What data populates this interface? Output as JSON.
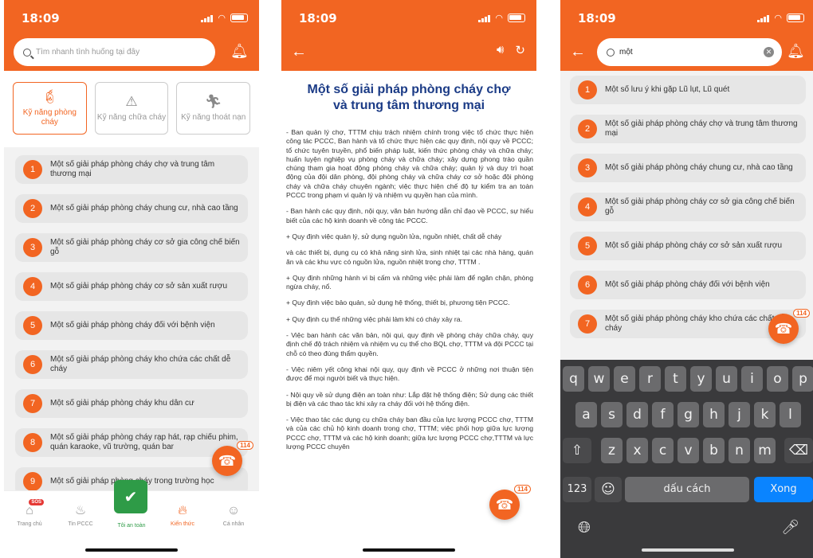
{
  "status": {
    "time": "18:09"
  },
  "screen1": {
    "search_placeholder": "Tìm nhanh tình huống tại đây",
    "skills": [
      {
        "icon": "fire-extinguisher-icon",
        "label": "Kỹ năng phòng cháy",
        "active": true
      },
      {
        "icon": "warning-icon",
        "label": "Kỹ năng chữa cháy",
        "active": false
      },
      {
        "icon": "running-person-icon",
        "label": "Kỹ năng thoát nạn",
        "active": false
      }
    ],
    "items": [
      {
        "num": "1",
        "text": "Một số giải pháp phòng cháy chợ và trung tâm thương mại"
      },
      {
        "num": "2",
        "text": "Một số giải pháp phòng cháy chung cư, nhà cao tầng"
      },
      {
        "num": "3",
        "text": "Một số giải pháp phòng cháy cơ sở gia công chế biến gỗ"
      },
      {
        "num": "4",
        "text": "Một số giải pháp phòng cháy cơ sở sản xuất rượu"
      },
      {
        "num": "5",
        "text": "Một số giải pháp phòng cháy đối với bệnh viện"
      },
      {
        "num": "6",
        "text": "Một số giải pháp phòng cháy kho chứa các chất dễ cháy"
      },
      {
        "num": "7",
        "text": "Một số giải pháp phòng cháy khu dân cư"
      },
      {
        "num": "8",
        "text": "Một số giải pháp phòng cháy rạp hát, rạp chiếu phim, quán karaoke, vũ trường, quán bar"
      },
      {
        "num": "9",
        "text": "Một số giải pháp phòng cháy trong trường học"
      }
    ],
    "tabs": [
      {
        "label": "Trang chủ",
        "icon": "home-icon",
        "badge": "SOS"
      },
      {
        "label": "Tin PCCC",
        "icon": "flame-icon"
      },
      {
        "label": "Tôi an toàn",
        "icon": "shield-check-icon"
      },
      {
        "label": "Kiến thức",
        "icon": "fire-icon"
      },
      {
        "label": "Cá nhân",
        "icon": "smiley-icon"
      }
    ],
    "fab_badge": "114"
  },
  "screen2": {
    "title": "Một số giải pháp phòng cháy chợ và trung tâm thương mại",
    "paragraphs": [
      "- Ban quản lý chợ, TTTM chịu trách nhiệm chính trong việc tổ chức thực hiện công tác PCCC, Ban hành và tổ chức thực hiện các quy định, nội quy về PCCC; tổ chức tuyên truyền, phổ biến pháp luật, kiến thức phòng cháy và chữa cháy; huấn luyện nghiệp vụ phòng cháy và chữa cháy; xây dựng phong trào quần chúng tham gia hoạt động phòng cháy và chữa cháy; quản lý và duy trì hoạt động của đội dân phòng, đội phòng cháy và chữa cháy cơ sở hoặc đội phòng cháy và chữa cháy chuyên ngành; việc thực hiện chế độ tự kiểm tra an toàn PCCC trong phạm vi quản lý và nhiệm vụ quyền hạn của mình.",
      "- Ban hành các quy định, nội quy, văn bản hướng dẫn chỉ đạo về PCCC, sự hiểu biết của các hộ kinh doanh về công tác PCCC.",
      "+ Quy định việc quản lý, sử dụng nguồn lửa, nguồn nhiệt, chất dễ cháy",
      "và các thiết bị, dụng cụ có khả năng sinh lửa, sinh nhiệt tại các nhà hàng, quán ăn và các khu vực có nguồn lửa, nguồn nhiệt trong chợ, TTTM .",
      "+ Quy định những hành vi bị cấm và những việc phải làm để ngăn chặn, phòng ngừa cháy, nổ.",
      "+ Quy định việc bảo quản, sử dụng hệ thống, thiết bị, phương tiện PCCC.",
      "+ Quy định cụ thể những việc phải làm khi có cháy xảy ra.",
      "- Việc ban hành các văn bản, nội qui, quy định về phòng cháy chữa cháy, quy định chế độ trách nhiệm và nhiệm vụ cụ thể cho BQL chợ, TTTM và đội PCCC tại chỗ có theo đúng thẩm quyền.",
      "- Việc niêm yết công khai nội quy, quy định về PCCC ở những nơi thuận tiện được để mọi người biết và thực hiện.",
      "- Nội quy về sử dụng điện an toàn như: Lắp đặt hệ thống điện; Sử dụng các thiết bị điện và các thao tác khi xảy ra cháy đối với hệ thống điện.",
      "- Việc thao tác các dụng cụ chữa cháy ban đầu của lực lượng PCCC chợ, TTTM và của các chủ hộ kinh doanh trong chợ, TTTM; việc phối hợp giữa lực lượng PCCC chợ, TTTM và các hộ kinh doanh; giữa lực lượng PCCC chợ,TTTM và lực lượng PCCC chuyên"
    ],
    "fab_badge": "114"
  },
  "screen3": {
    "search_value": "một",
    "items": [
      {
        "num": "1",
        "text": "Một số lưu ý khi gặp Lũ lụt, Lũ quét"
      },
      {
        "num": "2",
        "text": "Một số giải pháp phòng cháy chợ và trung tâm thương mại"
      },
      {
        "num": "3",
        "text": "Một số giải pháp phòng cháy chung cư, nhà cao tầng"
      },
      {
        "num": "4",
        "text": "Một số giải pháp phòng cháy cơ sở gia công chế biến gỗ"
      },
      {
        "num": "5",
        "text": "Một số giải pháp phòng cháy cơ sở sản xuất rượu"
      },
      {
        "num": "6",
        "text": "Một số giải pháp phòng cháy đối với bệnh viện"
      },
      {
        "num": "7",
        "text": "Một số giải pháp phòng cháy kho chứa các chất dễ cháy"
      }
    ],
    "fab_badge": "114",
    "keyboard": {
      "row1": [
        "q",
        "w",
        "e",
        "r",
        "t",
        "y",
        "u",
        "i",
        "o",
        "p"
      ],
      "row2": [
        "a",
        "s",
        "d",
        "f",
        "g",
        "h",
        "j",
        "k",
        "l"
      ],
      "row3": [
        "z",
        "x",
        "c",
        "v",
        "b",
        "n",
        "m"
      ],
      "numbers": "123",
      "space": "dấu cách",
      "done": "Xong"
    }
  },
  "colors": {
    "accent": "#f26522",
    "safe": "#2e9b47",
    "title": "#1b3b86",
    "keyboard_blue": "#0a84ff"
  }
}
